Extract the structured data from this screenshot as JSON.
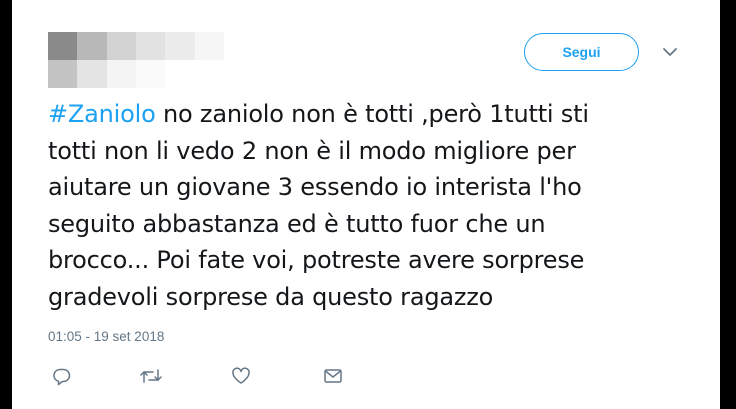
{
  "follow_button": {
    "label": "Segui"
  },
  "tweet": {
    "hashtag": "#Zaniolo",
    "line1_rest": " no zaniolo non è totti ,però 1tutti sti",
    "line2": "totti non li vedo 2 non è il modo migliore per",
    "line3": "aiutare un giovane 3 essendo io interista l'ho",
    "line4": "seguito abbastanza ed è tutto fuor che un",
    "line5": "brocco... Poi fate voi, potreste avere sorprese",
    "line6": "gradevoli sorprese da questo ragazzo",
    "timestamp": "01:05 - 19 set 2018"
  },
  "actions": {
    "reply_icon": "reply-icon",
    "retweet_icon": "retweet-icon",
    "like_icon": "heart-icon",
    "message_icon": "envelope-icon"
  },
  "colors": {
    "accent": "#1da1f2",
    "text": "#14171a",
    "muted": "#657786",
    "background": "#000000",
    "card": "#ffffff"
  }
}
